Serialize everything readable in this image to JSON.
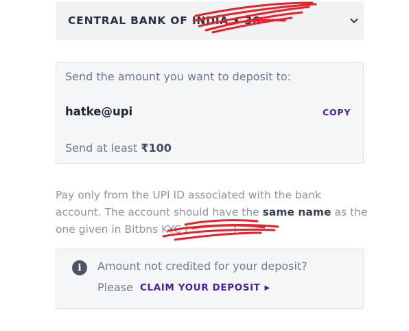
{
  "bank_selector": {
    "selected_bank": "CENTRAL BANK OF INDIA • 36",
    "icon": "chevron-down-icon"
  },
  "deposit_card": {
    "instruction": "Send the amount you want to deposit to:",
    "upi_id": "hatke@upi",
    "copy_label": "COPY",
    "min_prefix": "Send at least ",
    "min_amount": "₹100"
  },
  "note": {
    "part1": "Pay only from the UPI ID associated with the bank account. The account should have the ",
    "emphasis": "same name",
    "part2": " as the one given in Bitbns KYC (",
    "part3": ")"
  },
  "claim_box": {
    "icon": "info-icon",
    "question": "Amount not credited for your deposit?",
    "please": "Please",
    "cta_label": "CLAIM YOUR DEPOSIT"
  },
  "colors": {
    "accent": "#4a1f9e",
    "redaction": "#e8202a"
  }
}
